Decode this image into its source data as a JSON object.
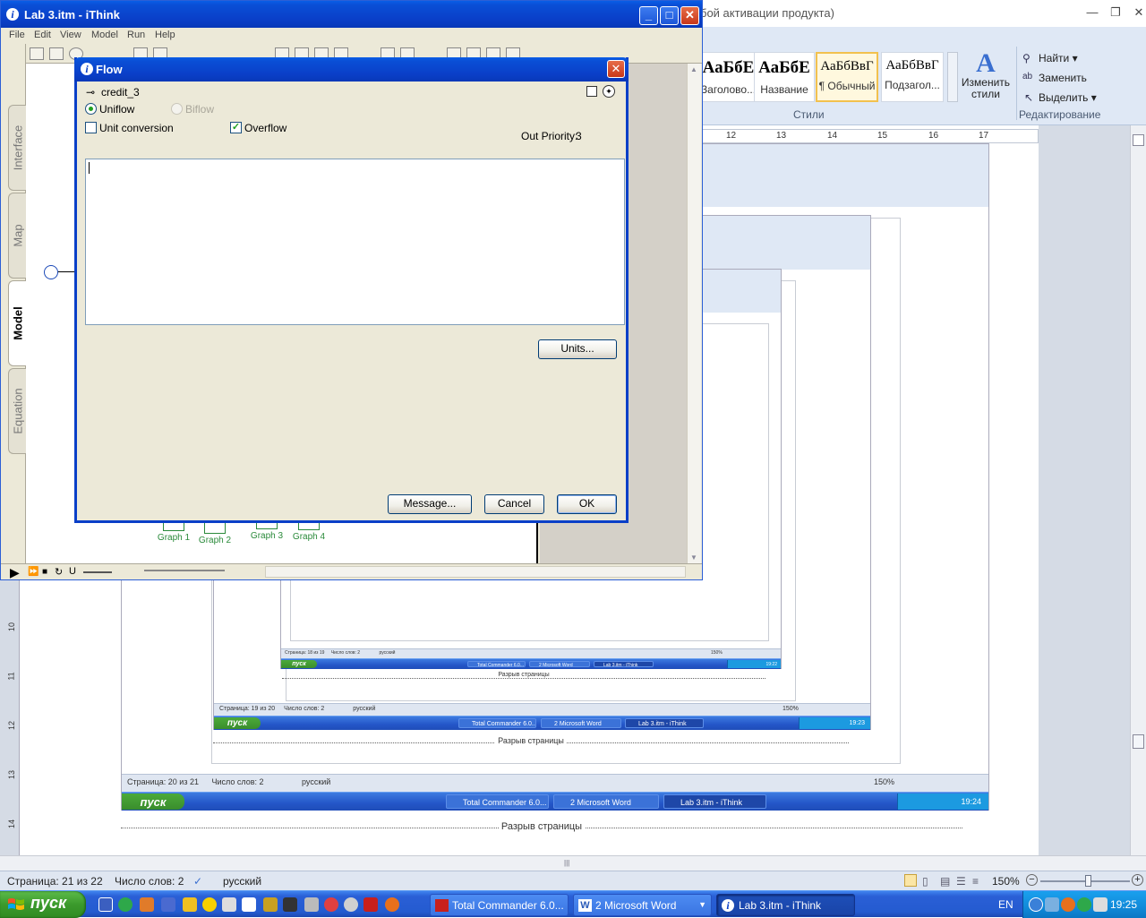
{
  "word": {
    "title_fragment": "бой активации продукта)",
    "styles": [
      {
        "sample": "АаБбЕ",
        "name": "Заголово..."
      },
      {
        "sample": "АаБбЕ",
        "name": "Название"
      },
      {
        "sample": "АаБбВвГ",
        "name": "¶ Обычный",
        "selected": true
      },
      {
        "sample": "АаБбВвГ",
        "name": "Подзагол..."
      }
    ],
    "change_styles": "Изменить стили",
    "styles_group": "Стили",
    "edit_find": "Найти",
    "edit_replace": "Заменить",
    "edit_select": "Выделить",
    "edit_group": "Редактирование",
    "ruler_ticks": [
      "12",
      "13",
      "14",
      "15",
      "16",
      "17"
    ],
    "left_ruler_ticks": [
      "10",
      "11",
      "12",
      "13",
      "14"
    ],
    "page_break": "Разрыв страницы",
    "status": {
      "page": "Страница: 21 из 22",
      "words": "Число слов: 2",
      "lang": "русский",
      "zoom": "150%"
    },
    "nested_status_1": {
      "page": "Страница: 20 из 21",
      "words": "Число слов: 2",
      "lang": "русский",
      "zoom": "150%"
    },
    "nested_status_2": {
      "page": "Страница: 19 из 20",
      "words": "Число слов: 2",
      "lang": "русский",
      "zoom": "150%"
    },
    "nested_status_3": {
      "page": "Страница: 18 из 19",
      "words": "Число слов: 2",
      "lang": "русский",
      "zoom": "150%"
    }
  },
  "taskbar": {
    "start": "пуск",
    "buttons": [
      {
        "label": "Total Commander 6.0..."
      },
      {
        "label": "2 Microsoft Word"
      },
      {
        "label": "Lab 3.itm - iThink"
      }
    ],
    "lang": "EN",
    "clock": "19:25",
    "nested_clocks": [
      "19:24",
      "19:23",
      "19:22"
    ]
  },
  "ithink": {
    "title": "Lab 3.itm - iThink",
    "menu": [
      "File",
      "Edit",
      "View",
      "Model",
      "Run",
      "Help"
    ],
    "tabs": [
      "Interface",
      "Map",
      "Model",
      "Equation"
    ],
    "active_tab": "Model",
    "graphs": [
      "Graph 1",
      "Graph 2",
      "Graph 3",
      "Graph 4"
    ]
  },
  "flow_dialog": {
    "title": "Flow",
    "name": "credit_3",
    "uniflow": "Uniflow",
    "biflow": "Biflow",
    "unit_conversion": "Unit conversion",
    "overflow": "Overflow",
    "out_priority_label": "Out Priority:",
    "out_priority_value": "3",
    "equation": "",
    "units_button": "Units...",
    "message_button": "Message...",
    "cancel_button": "Cancel",
    "ok_button": "OK",
    "uniflow_selected": true,
    "overflow_checked": true,
    "unit_conversion_checked": false
  },
  "colors": {
    "xp_blue": "#0a3fc8",
    "start_green": "#3b9a2c",
    "tray_blue": "#118ad9",
    "word_ribbon": "#dfe8f5"
  }
}
